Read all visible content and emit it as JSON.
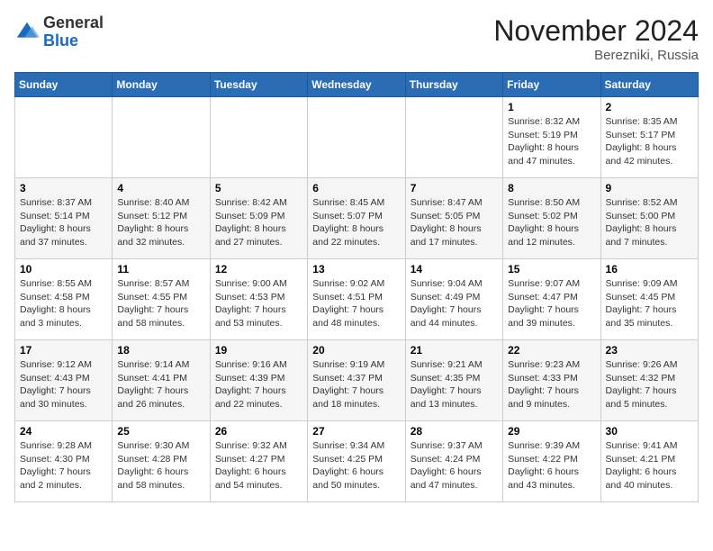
{
  "logo": {
    "general": "General",
    "blue": "Blue"
  },
  "header": {
    "month": "November 2024",
    "location": "Berezniki, Russia"
  },
  "weekdays": [
    "Sunday",
    "Monday",
    "Tuesday",
    "Wednesday",
    "Thursday",
    "Friday",
    "Saturday"
  ],
  "weeks": [
    [
      {
        "day": "",
        "info": ""
      },
      {
        "day": "",
        "info": ""
      },
      {
        "day": "",
        "info": ""
      },
      {
        "day": "",
        "info": ""
      },
      {
        "day": "",
        "info": ""
      },
      {
        "day": "1",
        "info": "Sunrise: 8:32 AM\nSunset: 5:19 PM\nDaylight: 8 hours and 47 minutes."
      },
      {
        "day": "2",
        "info": "Sunrise: 8:35 AM\nSunset: 5:17 PM\nDaylight: 8 hours and 42 minutes."
      }
    ],
    [
      {
        "day": "3",
        "info": "Sunrise: 8:37 AM\nSunset: 5:14 PM\nDaylight: 8 hours and 37 minutes."
      },
      {
        "day": "4",
        "info": "Sunrise: 8:40 AM\nSunset: 5:12 PM\nDaylight: 8 hours and 32 minutes."
      },
      {
        "day": "5",
        "info": "Sunrise: 8:42 AM\nSunset: 5:09 PM\nDaylight: 8 hours and 27 minutes."
      },
      {
        "day": "6",
        "info": "Sunrise: 8:45 AM\nSunset: 5:07 PM\nDaylight: 8 hours and 22 minutes."
      },
      {
        "day": "7",
        "info": "Sunrise: 8:47 AM\nSunset: 5:05 PM\nDaylight: 8 hours and 17 minutes."
      },
      {
        "day": "8",
        "info": "Sunrise: 8:50 AM\nSunset: 5:02 PM\nDaylight: 8 hours and 12 minutes."
      },
      {
        "day": "9",
        "info": "Sunrise: 8:52 AM\nSunset: 5:00 PM\nDaylight: 8 hours and 7 minutes."
      }
    ],
    [
      {
        "day": "10",
        "info": "Sunrise: 8:55 AM\nSunset: 4:58 PM\nDaylight: 8 hours and 3 minutes."
      },
      {
        "day": "11",
        "info": "Sunrise: 8:57 AM\nSunset: 4:55 PM\nDaylight: 7 hours and 58 minutes."
      },
      {
        "day": "12",
        "info": "Sunrise: 9:00 AM\nSunset: 4:53 PM\nDaylight: 7 hours and 53 minutes."
      },
      {
        "day": "13",
        "info": "Sunrise: 9:02 AM\nSunset: 4:51 PM\nDaylight: 7 hours and 48 minutes."
      },
      {
        "day": "14",
        "info": "Sunrise: 9:04 AM\nSunset: 4:49 PM\nDaylight: 7 hours and 44 minutes."
      },
      {
        "day": "15",
        "info": "Sunrise: 9:07 AM\nSunset: 4:47 PM\nDaylight: 7 hours and 39 minutes."
      },
      {
        "day": "16",
        "info": "Sunrise: 9:09 AM\nSunset: 4:45 PM\nDaylight: 7 hours and 35 minutes."
      }
    ],
    [
      {
        "day": "17",
        "info": "Sunrise: 9:12 AM\nSunset: 4:43 PM\nDaylight: 7 hours and 30 minutes."
      },
      {
        "day": "18",
        "info": "Sunrise: 9:14 AM\nSunset: 4:41 PM\nDaylight: 7 hours and 26 minutes."
      },
      {
        "day": "19",
        "info": "Sunrise: 9:16 AM\nSunset: 4:39 PM\nDaylight: 7 hours and 22 minutes."
      },
      {
        "day": "20",
        "info": "Sunrise: 9:19 AM\nSunset: 4:37 PM\nDaylight: 7 hours and 18 minutes."
      },
      {
        "day": "21",
        "info": "Sunrise: 9:21 AM\nSunset: 4:35 PM\nDaylight: 7 hours and 13 minutes."
      },
      {
        "day": "22",
        "info": "Sunrise: 9:23 AM\nSunset: 4:33 PM\nDaylight: 7 hours and 9 minutes."
      },
      {
        "day": "23",
        "info": "Sunrise: 9:26 AM\nSunset: 4:32 PM\nDaylight: 7 hours and 5 minutes."
      }
    ],
    [
      {
        "day": "24",
        "info": "Sunrise: 9:28 AM\nSunset: 4:30 PM\nDaylight: 7 hours and 2 minutes."
      },
      {
        "day": "25",
        "info": "Sunrise: 9:30 AM\nSunset: 4:28 PM\nDaylight: 6 hours and 58 minutes."
      },
      {
        "day": "26",
        "info": "Sunrise: 9:32 AM\nSunset: 4:27 PM\nDaylight: 6 hours and 54 minutes."
      },
      {
        "day": "27",
        "info": "Sunrise: 9:34 AM\nSunset: 4:25 PM\nDaylight: 6 hours and 50 minutes."
      },
      {
        "day": "28",
        "info": "Sunrise: 9:37 AM\nSunset: 4:24 PM\nDaylight: 6 hours and 47 minutes."
      },
      {
        "day": "29",
        "info": "Sunrise: 9:39 AM\nSunset: 4:22 PM\nDaylight: 6 hours and 43 minutes."
      },
      {
        "day": "30",
        "info": "Sunrise: 9:41 AM\nSunset: 4:21 PM\nDaylight: 6 hours and 40 minutes."
      }
    ]
  ]
}
